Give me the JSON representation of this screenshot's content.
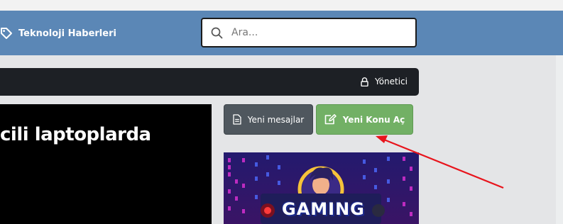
{
  "navbar": {
    "site_title": "Teknoloji Haberleri",
    "search_placeholder": "Ara..."
  },
  "admin_bar": {
    "admin_label": "Yönetici"
  },
  "hero": {
    "title_fragment": "cili laptoplarda"
  },
  "actions": {
    "new_messages_label": "Yeni mesajlar",
    "new_topic_label": "Yeni Konu Aç"
  },
  "banner": {
    "text": "GAMING"
  },
  "colors": {
    "navbar": "#5b87b6",
    "admin_bar": "#1d2025",
    "new_topic_button": "#72b065",
    "new_messages_button": "#4f575e",
    "annotation_arrow": "#e8141c"
  }
}
